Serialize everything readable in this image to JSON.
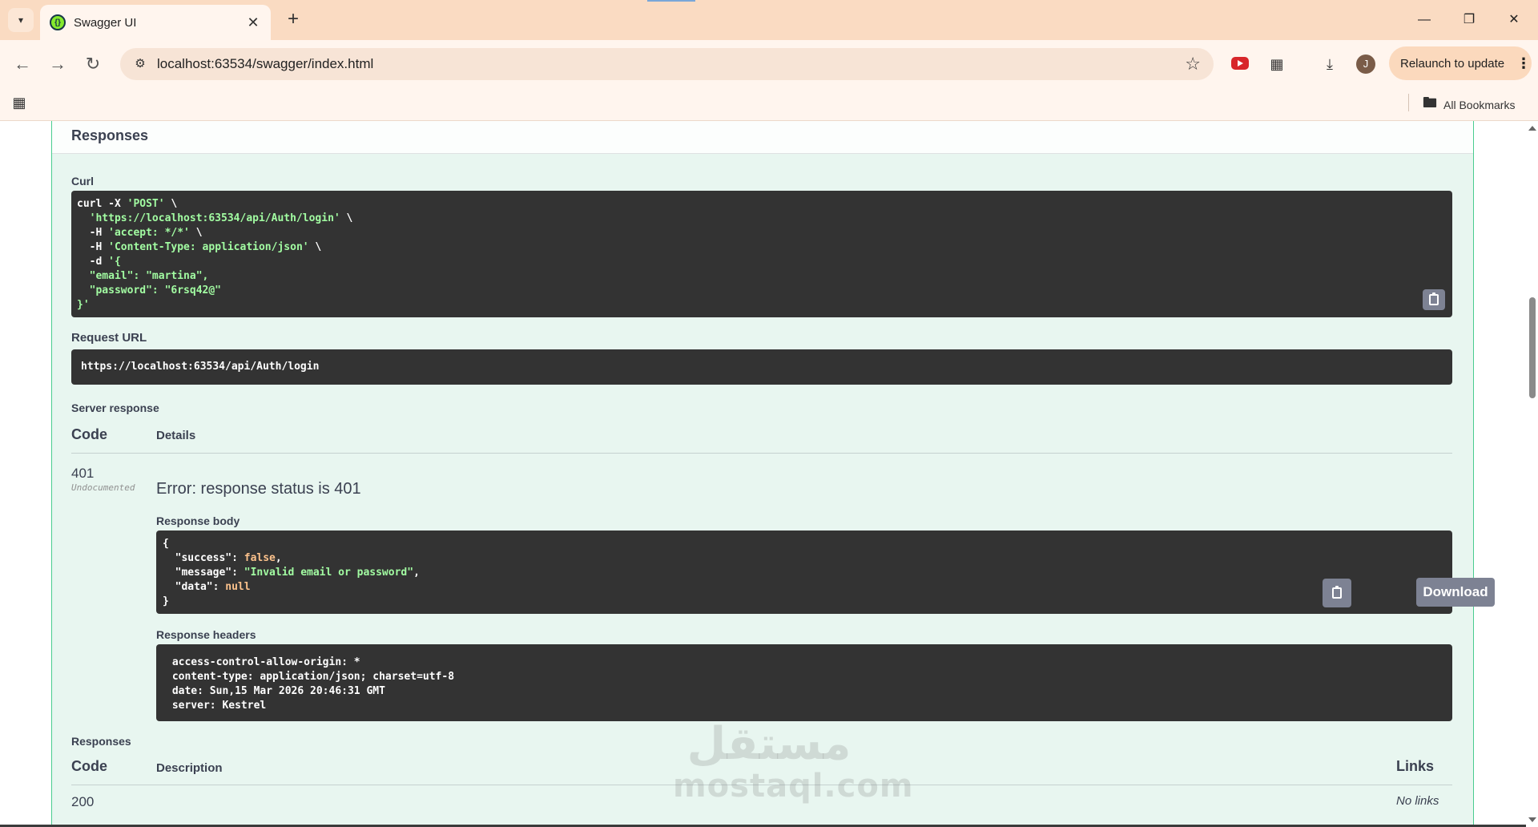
{
  "browser": {
    "tab_title": "Swagger UI",
    "tab_close": "✕",
    "new_tab": "+",
    "url": "localhost:63534/swagger/index.html",
    "relaunch_label": "Relaunch to update",
    "all_bookmarks": "All Bookmarks",
    "window_controls": {
      "minimize": "—",
      "restore": "❐",
      "close": "✕"
    },
    "icons": [
      "tab-search-icon",
      "swagger-favicon",
      "back-icon",
      "forward-icon",
      "reload-icon",
      "site-info-icon",
      "star-icon",
      "youtube-icon",
      "extensions-icon",
      "download-icon",
      "menu-dots-icon",
      "apps-grid-icon",
      "folder-icon"
    ],
    "avatar_letter": "J"
  },
  "swagger": {
    "responses_header": "Responses",
    "curl_label": "Curl",
    "curl_lines": {
      "l1_cmd": "curl -X ",
      "l1_str": "'POST'",
      "l1_end": " \\",
      "l2_str": "  'https://localhost:63534/api/Auth/login'",
      "l2_end": " \\",
      "l3_cmd": "  -H ",
      "l3_str": "'accept: */*'",
      "l3_end": " \\",
      "l4_cmd": "  -H ",
      "l4_str": "'Content-Type: application/json'",
      "l4_end": " \\",
      "l5_cmd": "  -d ",
      "l5_str": "'{",
      "l6_str": "  \"email\": \"martina\",",
      "l7_str": "  \"password\": \"6rsq42@\"",
      "l8_str": "}'"
    },
    "request_url_label": "Request URL",
    "request_url": "https://localhost:63534/api/Auth/login",
    "server_response_label": "Server response",
    "code_header": "Code",
    "details_header": "Details",
    "status_code": "401",
    "status_note": "Undocumented",
    "error_text": "Error: response status is 401",
    "response_body_label": "Response body",
    "body": {
      "open": "{",
      "k1": "  \"success\"",
      "v1": "false",
      "k2": "  \"message\"",
      "v2": "\"Invalid email or password\"",
      "k3": "  \"data\"",
      "v3": "null",
      "close": "}"
    },
    "download_label": "Download",
    "response_headers_label": "Response headers",
    "headers_lines": [
      " access-control-allow-origin: * ",
      " content-type: application/json; charset=utf-8 ",
      " date: Sun,15 Mar 2026 20:46:31 GMT ",
      " server: Kestrel "
    ],
    "responses_label": "Responses",
    "resp_code_header": "Code",
    "resp_description_header": "Description",
    "resp_links_header": "Links",
    "resp_first_code": "200",
    "resp_first_links": "No links"
  },
  "watermark": {
    "arabic": "مستقل",
    "latin": "mostaql.com"
  },
  "colors": {
    "chrome": "#fadbc2",
    "toolbar": "#fff5ee",
    "post_green": "#49cc90",
    "post_bg": "#e8f6f0",
    "code_bg": "#333333",
    "code_string": "#a2fca2",
    "code_keyword": "#fcc28c"
  }
}
